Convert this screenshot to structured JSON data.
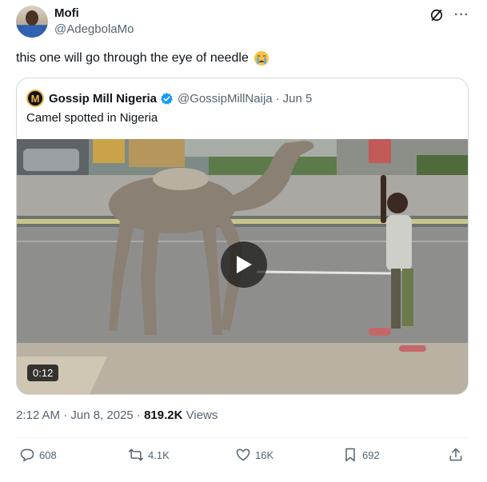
{
  "author": {
    "name": "Mofi",
    "handle": "@AdegbolaMo"
  },
  "tweet": {
    "text": "this one will go through the eye of needle",
    "emoji": "crying-face-emoji"
  },
  "quoted": {
    "avatar_letter": "M",
    "name": "Gossip Mill Nigeria",
    "handle": "@GossipMillNaija",
    "separator": "·",
    "date": "Jun 5",
    "text": "Camel spotted in Nigeria",
    "video_duration": "0:12"
  },
  "meta": {
    "time_date": "2:12 AM · Jun 8, 2025 · ",
    "views_count": "819.2K",
    "views_label": " Views"
  },
  "actions": {
    "replies": "608",
    "reposts": "4.1K",
    "likes": "16K",
    "bookmarks": "692"
  },
  "colors": {
    "verified": "#1d9bf0",
    "secondary_text": "#536471",
    "border": "#cfd9de"
  },
  "icons": [
    "grok-icon",
    "more-icon",
    "verified-icon",
    "play-icon",
    "reply-icon",
    "repost-icon",
    "like-icon",
    "bookmark-icon",
    "share-icon"
  ]
}
